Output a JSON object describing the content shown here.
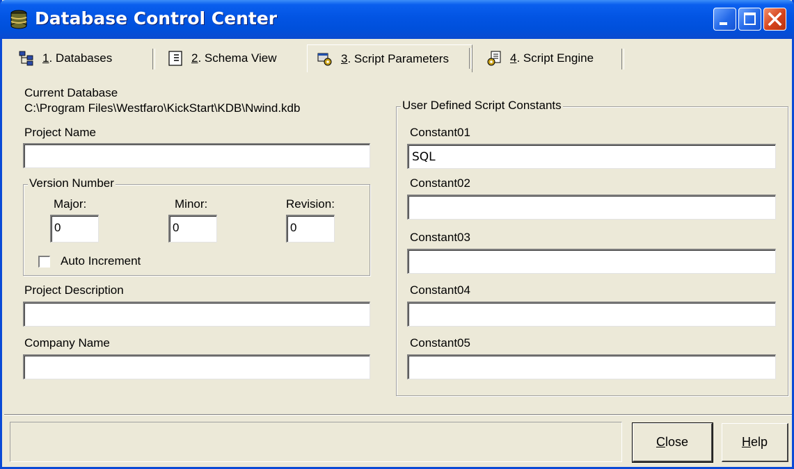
{
  "window": {
    "title": "Database Control Center"
  },
  "tabs": [
    {
      "accel": "1",
      "rest": ". Databases",
      "icon": "database-tree-icon"
    },
    {
      "accel": "2",
      "rest": ". Schema View",
      "icon": "document-list-icon"
    },
    {
      "accel": "3",
      "rest": ". Script Parameters",
      "icon": "gear-parameters-icon"
    },
    {
      "accel": "4",
      "rest": ". Script Engine",
      "icon": "script-gear-icon"
    }
  ],
  "active_tab": 2,
  "left": {
    "current_db_label": "Current Database",
    "current_db_path": "C:\\Program Files\\Westfaro\\KickStart\\KDB\\Nwind.kdb",
    "project_name_label": "Project Name",
    "project_name_value": "",
    "version": {
      "title": "Version Number",
      "major_label": "Major:",
      "minor_label": "Minor:",
      "revision_label": "Revision:",
      "major_value": "0",
      "minor_value": "0",
      "revision_value": "0",
      "auto_increment_label": "Auto Increment",
      "auto_increment_checked": false
    },
    "project_desc_label": "Project Description",
    "project_desc_value": "",
    "company_label": "Company Name",
    "company_value": ""
  },
  "right": {
    "group_title": "User Defined Script Constants",
    "constants": [
      {
        "label": "Constant01",
        "value": "SQL"
      },
      {
        "label": "Constant02",
        "value": ""
      },
      {
        "label": "Constant03",
        "value": ""
      },
      {
        "label": "Constant04",
        "value": ""
      },
      {
        "label": "Constant05",
        "value": ""
      }
    ]
  },
  "buttons": {
    "close_accel": "C",
    "close_rest": "lose",
    "help_accel": "H",
    "help_rest": "elp"
  }
}
